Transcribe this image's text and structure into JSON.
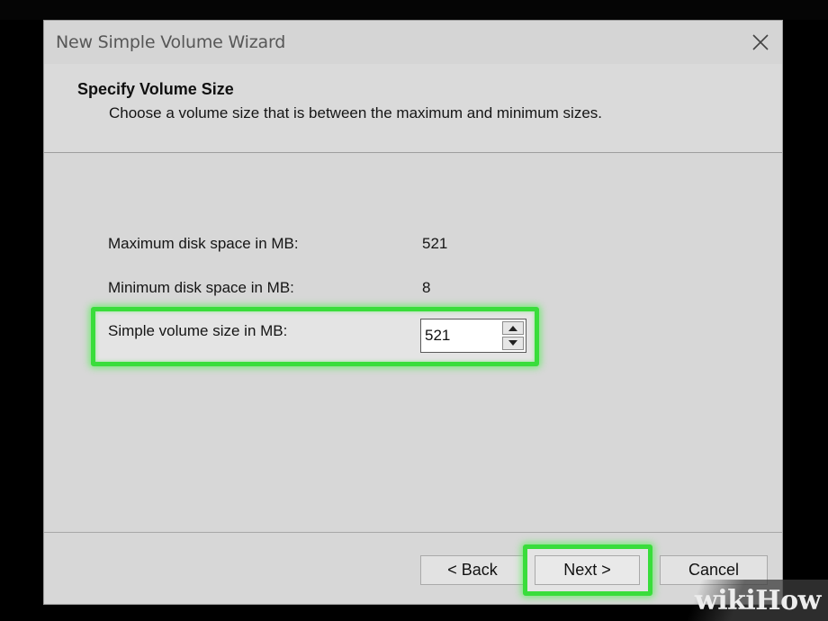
{
  "window": {
    "title": "New Simple Volume Wizard",
    "close_icon": "close-icon"
  },
  "header": {
    "title": "Specify Volume Size",
    "subtitle": "Choose a volume size that is between the maximum and minimum sizes."
  },
  "fields": {
    "max_label": "Maximum disk space in MB:",
    "max_value": "521",
    "min_label": "Minimum disk space in MB:",
    "min_value": "8",
    "size_label": "Simple volume size in MB:",
    "size_value": "521"
  },
  "buttons": {
    "back": "< Back",
    "next": "Next >",
    "cancel": "Cancel"
  },
  "watermark": {
    "text": "wikiHow"
  },
  "colors": {
    "highlight": "#39dd3b",
    "dialog_bg": "#d7d7d7"
  }
}
